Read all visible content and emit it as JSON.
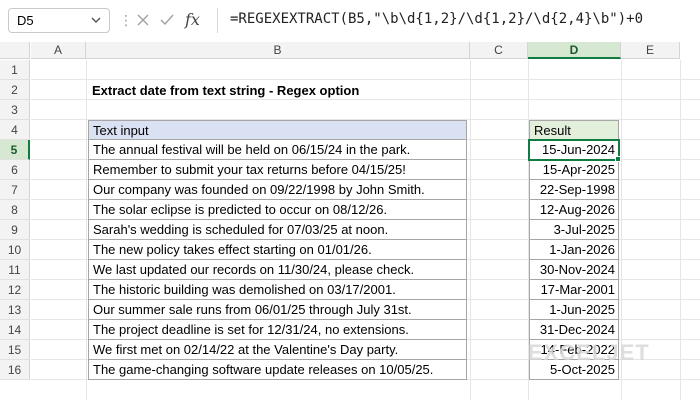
{
  "formula_bar": {
    "name_box": "D5",
    "formula": "=REGEXEXTRACT(B5,\"\\b\\d{1,2}/\\d{1,2}/\\d{2,4}\\b\")+0",
    "fx_label": "fx"
  },
  "columns": [
    "A",
    "B",
    "C",
    "D",
    "E"
  ],
  "rows": [
    "1",
    "2",
    "3",
    "4",
    "5",
    "6",
    "7",
    "8",
    "9",
    "10",
    "11",
    "12",
    "13",
    "14",
    "15",
    "16"
  ],
  "sheet": {
    "title": "Extract date from text string - Regex option",
    "text_header": "Text input",
    "result_header": "Result",
    "entries": [
      {
        "text": "The annual festival will be held on 06/15/24 in the park.",
        "result": "15-Jun-2024"
      },
      {
        "text": "Remember to submit your tax returns before 04/15/25!",
        "result": "15-Apr-2025"
      },
      {
        "text": "Our company was founded on 09/22/1998 by John Smith.",
        "result": "22-Sep-1998"
      },
      {
        "text": "The solar eclipse is predicted to occur on 08/12/26.",
        "result": "12-Aug-2026"
      },
      {
        "text": "Sarah's wedding is scheduled for 07/03/25 at noon.",
        "result": "3-Jul-2025"
      },
      {
        "text": "The new policy takes effect starting on 01/01/26.",
        "result": "1-Jan-2026"
      },
      {
        "text": "We last updated our records on 11/30/24, please check.",
        "result": "30-Nov-2024"
      },
      {
        "text": "The historic building was demolished on 03/17/2001.",
        "result": "17-Mar-2001"
      },
      {
        "text": "Our summer sale runs from 06/01/25 through July 31st.",
        "result": "1-Jun-2025"
      },
      {
        "text": "The project deadline is set for 12/31/24, no extensions.",
        "result": "31-Dec-2024"
      },
      {
        "text": "We first met on 02/14/22 at the Valentine's Day party.",
        "result": "14-Feb-2022"
      },
      {
        "text": "The game-changing software update releases on 10/05/25.",
        "result": "5-Oct-2025"
      }
    ]
  },
  "watermark": "EXCELJET",
  "colors": {
    "accent": "#107c41",
    "table_header": "#d9e1f2",
    "result_header": "#e2efda"
  }
}
